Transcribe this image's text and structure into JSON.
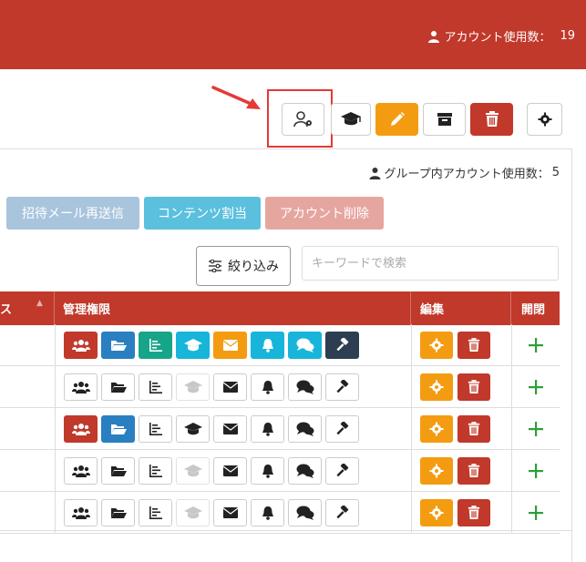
{
  "header": {
    "account_usage_label": "アカウント使用数：",
    "account_usage_count": "19"
  },
  "toolbar": {
    "buttons": [
      {
        "icon": "user-gear-icon"
      },
      {
        "icon": "graduation-cap-icon"
      },
      {
        "icon": "pencil-icon"
      },
      {
        "icon": "archive-icon"
      },
      {
        "icon": "trash-icon"
      },
      {
        "icon": "gear-icon"
      }
    ]
  },
  "group_usage": {
    "label": "グループ内アカウント使用数：",
    "count": "5"
  },
  "actions": {
    "resend_invite": "招待メール再送信",
    "assign_content": "コンテンツ割当",
    "delete_account": "アカウント削除"
  },
  "filter": {
    "label": "絞り込み"
  },
  "search": {
    "placeholder": "キーワードで検索"
  },
  "table": {
    "headers": {
      "status": "ス",
      "permissions": "管理権限",
      "edit": "編集",
      "open": "開閉"
    },
    "permission_icons": [
      "users-icon",
      "folder-open-icon",
      "chart-icon",
      "graduation-cap-icon",
      "envelope-icon",
      "bell-icon",
      "comments-icon",
      "gavel-icon"
    ],
    "permission_colors": [
      "#c0392b",
      "#2a7fc1",
      "#17a589",
      "#17b5d9",
      "#f39c12",
      "#17b5d9",
      "#17b5d9",
      "#2c3e50"
    ],
    "rows": [
      {
        "perms": [
          true,
          true,
          true,
          true,
          true,
          true,
          true,
          true
        ],
        "disabled": [
          false,
          false,
          false,
          false,
          false,
          false,
          false,
          false
        ]
      },
      {
        "perms": [
          false,
          false,
          false,
          false,
          false,
          false,
          false,
          false
        ],
        "disabled": [
          false,
          false,
          false,
          true,
          false,
          false,
          false,
          false
        ]
      },
      {
        "perms": [
          true,
          true,
          false,
          false,
          false,
          false,
          false,
          false
        ],
        "disabled": [
          false,
          false,
          false,
          false,
          false,
          false,
          false,
          false
        ]
      },
      {
        "perms": [
          false,
          false,
          false,
          false,
          false,
          false,
          false,
          false
        ],
        "disabled": [
          false,
          false,
          false,
          true,
          false,
          false,
          false,
          false
        ]
      },
      {
        "perms": [
          false,
          false,
          false,
          false,
          false,
          false,
          false,
          false
        ],
        "disabled": [
          false,
          false,
          false,
          true,
          false,
          false,
          false,
          false
        ]
      }
    ]
  },
  "colors": {
    "brand_red": "#c0392b",
    "orange": "#f39c12",
    "danger": "#c0392b",
    "resend_bg": "#a9c4dd",
    "assign_bg": "#5bc0de",
    "delete_bg": "#e6a6a0",
    "plus_green": "#2e9e3a"
  }
}
